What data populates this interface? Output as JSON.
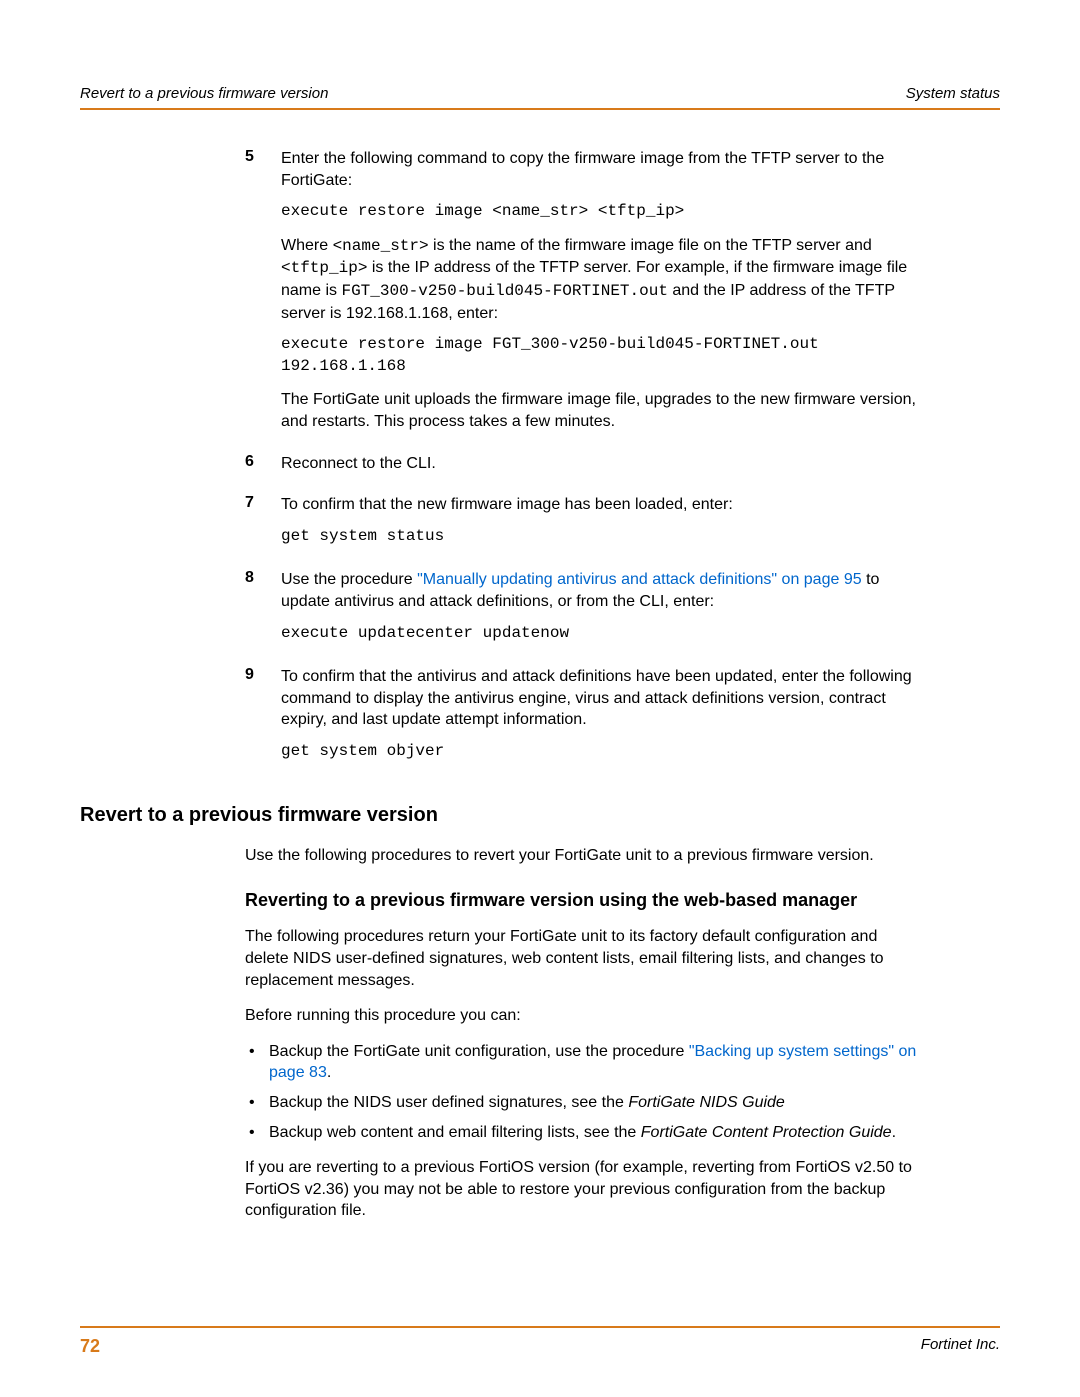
{
  "header": {
    "left": "Revert to a previous firmware version",
    "right": "System status"
  },
  "steps": {
    "s5": {
      "num": "5",
      "p1": "Enter the following command to copy the firmware image from the TFTP server to the FortiGate:",
      "code1": "execute restore image <name_str> <tftp_ip>",
      "p2a": "Where ",
      "p2_code1": "<name_str>",
      "p2b": " is the name of the firmware image file on the TFTP server and ",
      "p2_code2": "<tftp_ip>",
      "p2c": " is the IP address of the TFTP server. For example, if the firmware image file name is ",
      "p2_code3": "FGT_300-v250-build045-FORTINET.out",
      "p2d": " and the IP address of the TFTP server is 192.168.1.168, enter:",
      "code2": "execute restore image FGT_300-v250-build045-FORTINET.out 192.168.1.168",
      "p3": "The FortiGate unit uploads the firmware image file, upgrades to the new firmware version, and restarts. This process takes a few minutes."
    },
    "s6": {
      "num": "6",
      "p1": "Reconnect to the CLI."
    },
    "s7": {
      "num": "7",
      "p1": "To confirm that the new firmware image has been loaded, enter:",
      "code1": "get system status"
    },
    "s8": {
      "num": "8",
      "p1a": "Use the procedure ",
      "link": "\"Manually updating antivirus and attack definitions\" on page 95",
      "p1b": " to update antivirus and attack definitions, or from the CLI, enter:",
      "code1": "execute updatecenter updatenow"
    },
    "s9": {
      "num": "9",
      "p1": "To confirm that the antivirus and attack definitions have been updated, enter the following command to display the antivirus engine, virus and attack definitions version, contract expiry, and last update attempt information.",
      "code1": "get system objver"
    }
  },
  "section": {
    "h2": "Revert to a previous firmware version",
    "intro": "Use the following procedures to revert your FortiGate unit to a previous firmware version.",
    "h3": "Reverting to a previous firmware version using the web-based manager",
    "p1": "The following procedures return your FortiGate unit to its factory default configuration and delete NIDS user-defined signatures, web content lists, email filtering lists, and changes to replacement messages.",
    "p2": "Before running this procedure you can:",
    "bul1a": "Backup the FortiGate unit configuration, use the procedure ",
    "bul1link": "\"Backing up system settings\" on page 83",
    "bul1b": ".",
    "bul2a": "Backup the NIDS user defined signatures, see the ",
    "bul2i": "FortiGate NIDS Guide",
    "bul3a": "Backup web content and email filtering lists, see the ",
    "bul3i": "FortiGate Content Protection Guide",
    "bul3b": ".",
    "p3": "If you are reverting to a previous FortiOS version (for example, reverting from FortiOS v2.50 to FortiOS v2.36) you may not be able to restore your previous configuration from the backup configuration file."
  },
  "footer": {
    "page": "72",
    "right": "Fortinet Inc."
  }
}
